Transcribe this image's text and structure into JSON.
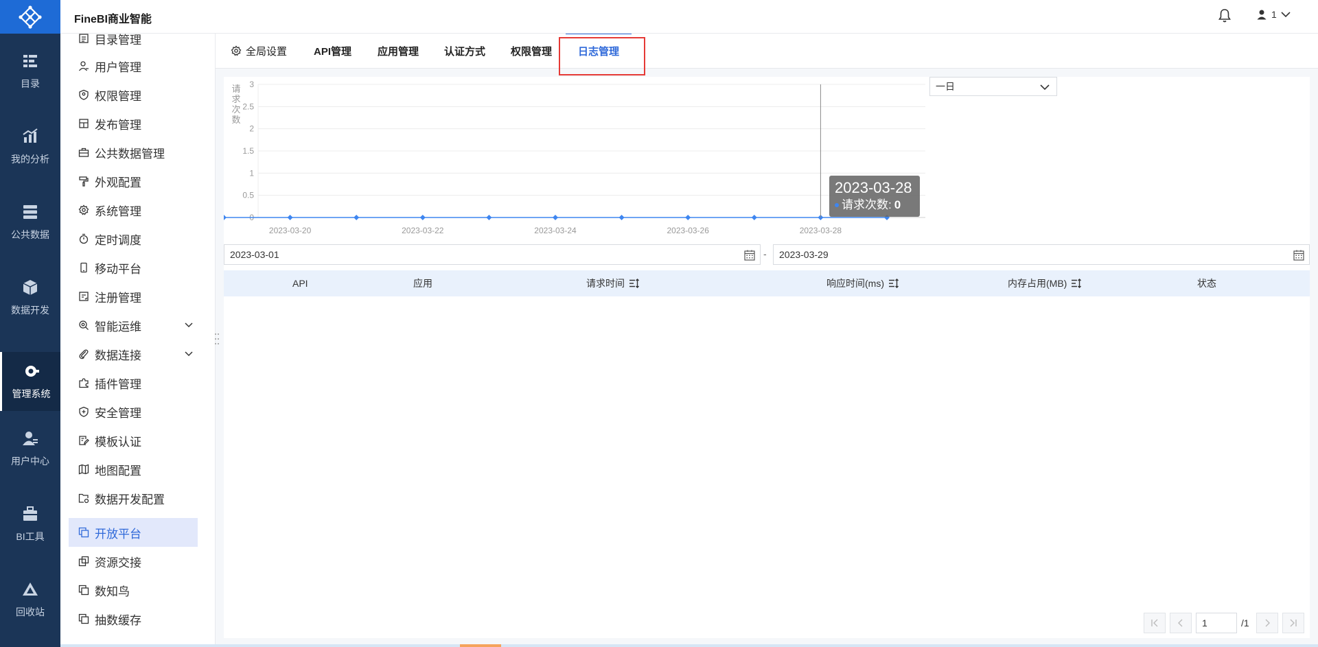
{
  "app": {
    "title": "FineBI商业智能"
  },
  "header": {
    "user_name": "1"
  },
  "rail": {
    "items": [
      {
        "label": "目录",
        "icon": "catalog-icon"
      },
      {
        "label": "我的分析",
        "icon": "analysis-icon"
      },
      {
        "label": "公共数据",
        "icon": "public-data-icon"
      },
      {
        "label": "数据开发",
        "icon": "data-dev-icon"
      },
      {
        "label": "管理系统",
        "icon": "admin-gear-icon",
        "active": true
      },
      {
        "label": "用户中心",
        "icon": "user-center-icon"
      },
      {
        "label": "BI工具",
        "icon": "toolbox-icon"
      },
      {
        "label": "回收站",
        "icon": "recycle-icon"
      }
    ]
  },
  "subnav": {
    "items": [
      {
        "label": "目录管理"
      },
      {
        "label": "用户管理"
      },
      {
        "label": "权限管理"
      },
      {
        "label": "发布管理"
      },
      {
        "label": "公共数据管理"
      },
      {
        "label": "外观配置"
      },
      {
        "label": "系统管理"
      },
      {
        "label": "定时调度"
      },
      {
        "label": "移动平台"
      },
      {
        "label": "注册管理"
      },
      {
        "label": "智能运维",
        "expandable": true
      },
      {
        "label": "数据连接",
        "expandable": true
      },
      {
        "label": "插件管理"
      },
      {
        "label": "安全管理"
      },
      {
        "label": "模板认证"
      },
      {
        "label": "地图配置"
      },
      {
        "label": "数据开发配置"
      },
      {
        "label": "开放平台",
        "active": true
      },
      {
        "label": "资源交接"
      },
      {
        "label": "数知鸟"
      },
      {
        "label": "抽数缓存"
      }
    ]
  },
  "tabs": [
    {
      "label": "全局设置"
    },
    {
      "label": "API管理"
    },
    {
      "label": "应用管理"
    },
    {
      "label": "认证方式"
    },
    {
      "label": "权限管理"
    },
    {
      "label": "日志管理",
      "active": true
    }
  ],
  "chart_data": {
    "type": "line",
    "ylabel": "请求次数",
    "ylim": [
      0,
      3
    ],
    "yticks": [
      "0",
      "0.5",
      "1",
      "1.5",
      "2",
      "2.5",
      "3"
    ],
    "x": [
      "2023-03-19",
      "2023-03-20",
      "2023-03-21",
      "2023-03-22",
      "2023-03-23",
      "2023-03-24",
      "2023-03-25",
      "2023-03-26",
      "2023-03-27",
      "2023-03-28",
      "2023-03-29"
    ],
    "xtick_labels": [
      "2023-03-20",
      "2023-03-22",
      "2023-03-24",
      "2023-03-26",
      "2023-03-28"
    ],
    "series": [
      {
        "name": "请求次数",
        "values": [
          0,
          0,
          0,
          0,
          0,
          0,
          0,
          0,
          0,
          0,
          0
        ],
        "color": "#3e86f0"
      }
    ],
    "tooltip": {
      "date": "2023-03-28",
      "label": "请求次数:",
      "value": "0"
    }
  },
  "filters": {
    "period": "一日",
    "start_date": "2023-03-01",
    "end_date": "2023-03-29",
    "separator": "-"
  },
  "table": {
    "columns": [
      {
        "label": "API",
        "sortable": false
      },
      {
        "label": "应用",
        "sortable": false
      },
      {
        "label": "请求时间",
        "sortable": true
      },
      {
        "label": "响应时间(ms)",
        "sortable": true
      },
      {
        "label": "内存占用(MB)",
        "sortable": true
      },
      {
        "label": "状态",
        "sortable": false
      }
    ],
    "rows": []
  },
  "pagination": {
    "current": "1",
    "total": "/1"
  },
  "colors": {
    "brand": "#1e6bd6",
    "rail": "#1b3557",
    "accent": "#2f69d9",
    "highlight": "#e53935"
  }
}
